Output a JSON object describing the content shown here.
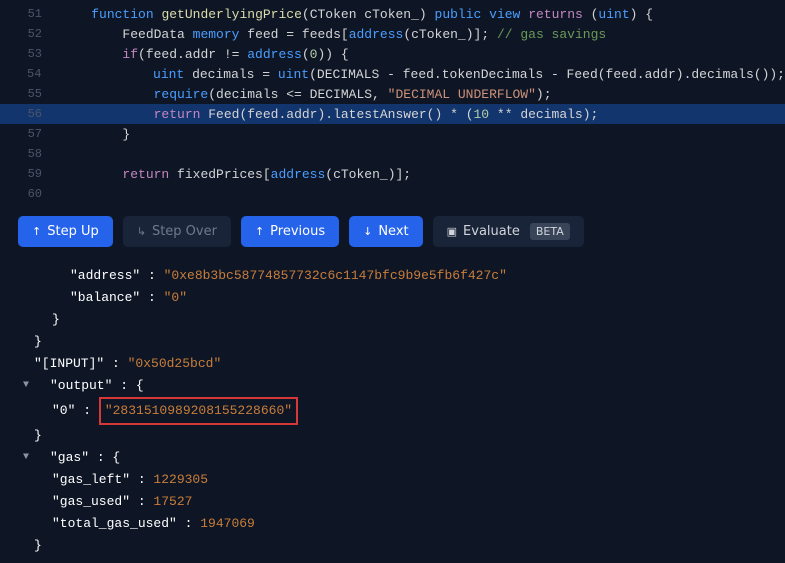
{
  "editor": {
    "lines": [
      {
        "n": "51",
        "hl": false,
        "html": "    <span class='k-blue'>function</span> <span class='k-fn'>getUnderlyingPrice</span><span class='k-w'>(CToken cToken_)</span> <span class='k-blue'>public</span> <span class='k-blue'>view</span> <span class='k-purple'>returns</span> <span class='k-w'>(</span><span class='k-blue'>uint</span><span class='k-w'>) {</span>"
      },
      {
        "n": "52",
        "hl": false,
        "html": "        <span class='k-w'>FeedData</span> <span class='k-blue'>memory</span> <span class='k-w'>feed = feeds[</span><span class='k-blue'>address</span><span class='k-w'>(cToken_)];</span> <span class='k-comment'>// gas savings</span>"
      },
      {
        "n": "53",
        "hl": false,
        "html": "        <span class='k-purple'>if</span><span class='k-w'>(feed.addr != </span><span class='k-blue'>address</span><span class='k-w'>(</span><span class='k-num'>0</span><span class='k-w'>)) {</span>"
      },
      {
        "n": "54",
        "hl": false,
        "html": "            <span class='k-blue'>uint</span> <span class='k-w'>decimals = </span><span class='k-blue'>uint</span><span class='k-w'>(DECIMALS - feed.tokenDecimals - Feed(feed.addr).decimals());</span>"
      },
      {
        "n": "55",
        "hl": false,
        "html": "            <span class='k-blue'>require</span><span class='k-w'>(decimals &lt;= DECIMALS, </span><span class='k-str'>\"DECIMAL UNDERFLOW\"</span><span class='k-w'>);</span>"
      },
      {
        "n": "56",
        "hl": true,
        "html": "            <span class='k-purple'>return</span> <span class='k-w'>Feed(feed.addr).latestAnswer() * (</span><span class='k-num'>10</span> <span class='k-w'>** decimals);</span>"
      },
      {
        "n": "57",
        "hl": false,
        "html": "        <span class='k-w'>}</span>"
      },
      {
        "n": "58",
        "hl": false,
        "html": ""
      },
      {
        "n": "59",
        "hl": false,
        "html": "        <span class='k-purple'>return</span> <span class='k-w'>fixedPrices[</span><span class='k-blue'>address</span><span class='k-w'>(cToken_)];</span>"
      },
      {
        "n": "60",
        "hl": false,
        "html": "        <span class='k-w' style='opacity:.5'></span>"
      }
    ]
  },
  "toolbar": {
    "step_up": "Step Up",
    "step_over": "Step Over",
    "previous": "Previous",
    "next": "Next",
    "evaluate": "Evaluate",
    "beta": "BETA"
  },
  "output": {
    "address_key": "\"address\"",
    "address_val": "\"0xe8b3bc58774857732c6c1147bfc9b9e5fb6f427c\"",
    "balance_key": "\"balance\"",
    "balance_val": "\"0\"",
    "input_key": "\"[INPUT]\"",
    "input_val": "\"0x50d25bcd\"",
    "output_key": "\"output\"",
    "output_idx": "\"0\"",
    "output_val": "\"2831510989208155228660\"",
    "gas_key": "\"gas\"",
    "gas_left_key": "\"gas_left\"",
    "gas_left_val": "1229305",
    "gas_used_key": "\"gas_used\"",
    "gas_used_val": "17527",
    "total_gas_key": "\"total_gas_used\"",
    "total_gas_val": "1947069"
  }
}
